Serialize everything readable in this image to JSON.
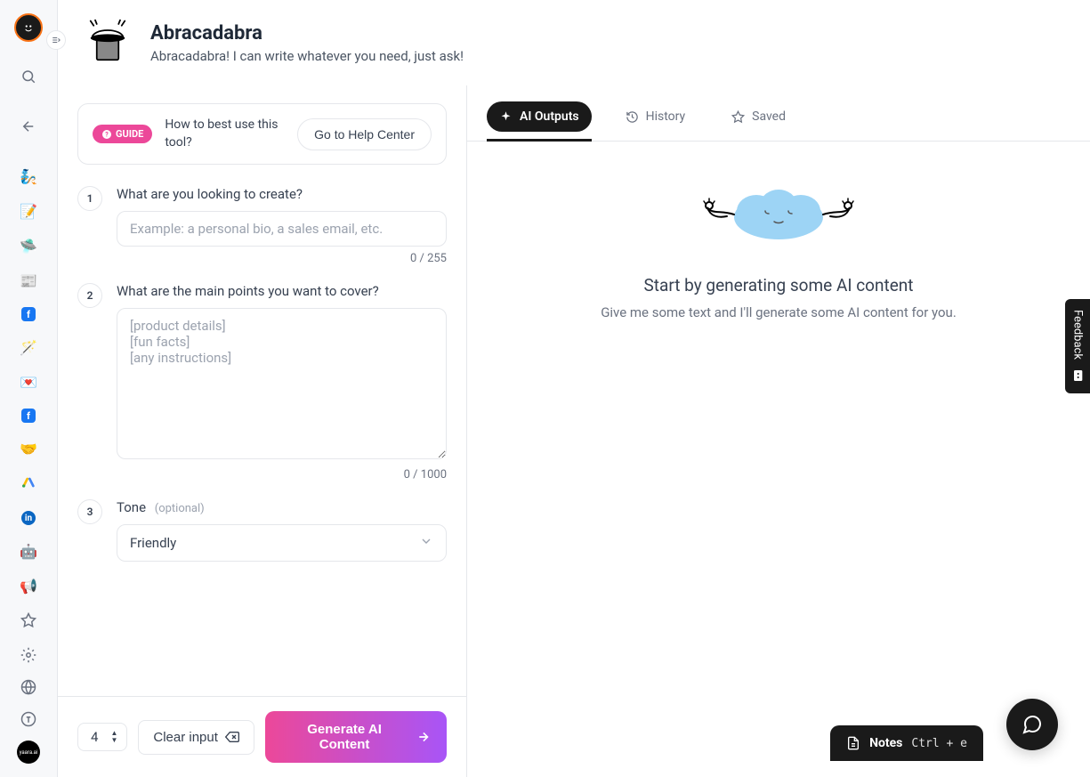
{
  "brand": "abracad",
  "header": {
    "title": "Abracadabra",
    "subtitle": "Abracadabra! I can write whatever you need, just ask!"
  },
  "guide": {
    "badge": "GUIDE",
    "question": "How to best use this tool?",
    "help_button": "Go to Help Center"
  },
  "form": {
    "step1": {
      "num": "1",
      "label": "What are you looking to create?",
      "placeholder": "Example: a personal bio, a sales email, etc.",
      "counter": "0 / 255"
    },
    "step2": {
      "num": "2",
      "label": "What are the main points you want to cover?",
      "placeholder": "[product details]\n[fun facts]\n[any instructions]",
      "counter": "0 / 1000"
    },
    "step3": {
      "num": "3",
      "label": "Tone",
      "optional": "(optional)",
      "value": "Friendly"
    }
  },
  "footer": {
    "quantity": "4",
    "clear": "Clear input",
    "generate": "Generate AI Content"
  },
  "tabs": {
    "outputs": "AI Outputs",
    "history": "History",
    "saved": "Saved"
  },
  "empty": {
    "title": "Start by generating some AI content",
    "sub": "Give me some text and I'll generate some AI content for you."
  },
  "feedback": "Feedback",
  "notes": {
    "label": "Notes",
    "shortcut": "Ctrl + e"
  },
  "logo_text": "yaara.ai"
}
